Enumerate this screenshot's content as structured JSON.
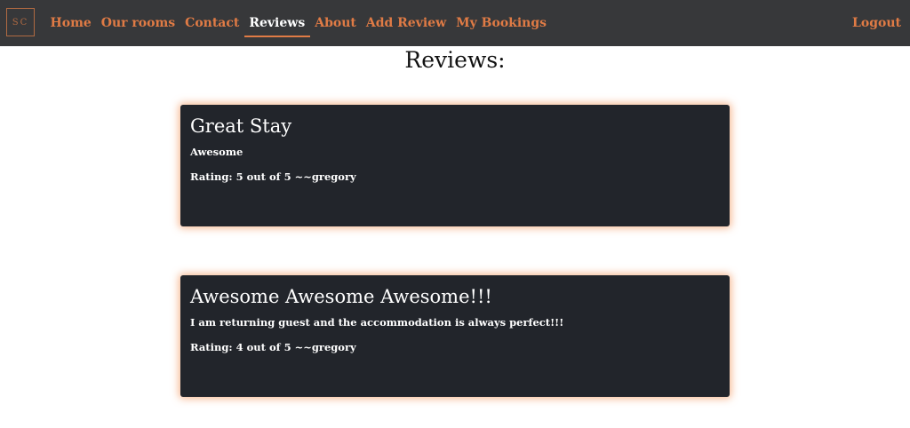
{
  "nav": {
    "logo_text": "SC",
    "links": [
      "Home",
      "Our rooms",
      "Contact",
      "Reviews",
      "About",
      "Add Review",
      "My Bookings"
    ],
    "active_index": 3,
    "logout_label": "Logout"
  },
  "page": {
    "title": "Reviews:"
  },
  "reviews": [
    {
      "title": "Great Stay",
      "body": "Awesome",
      "rating_text": "Rating: 5 out of 5 ~~gregory"
    },
    {
      "title": "Awesome Awesome Awesome!!!",
      "body": "I am returning guest and the accommodation is always perfect!!!",
      "rating_text": "Rating: 4 out of 5 ~~gregory"
    }
  ],
  "colors": {
    "navbar_bg": "#37383a",
    "accent": "#e07b45",
    "card_bg": "#22252b",
    "card_glow": "#f0823c"
  }
}
